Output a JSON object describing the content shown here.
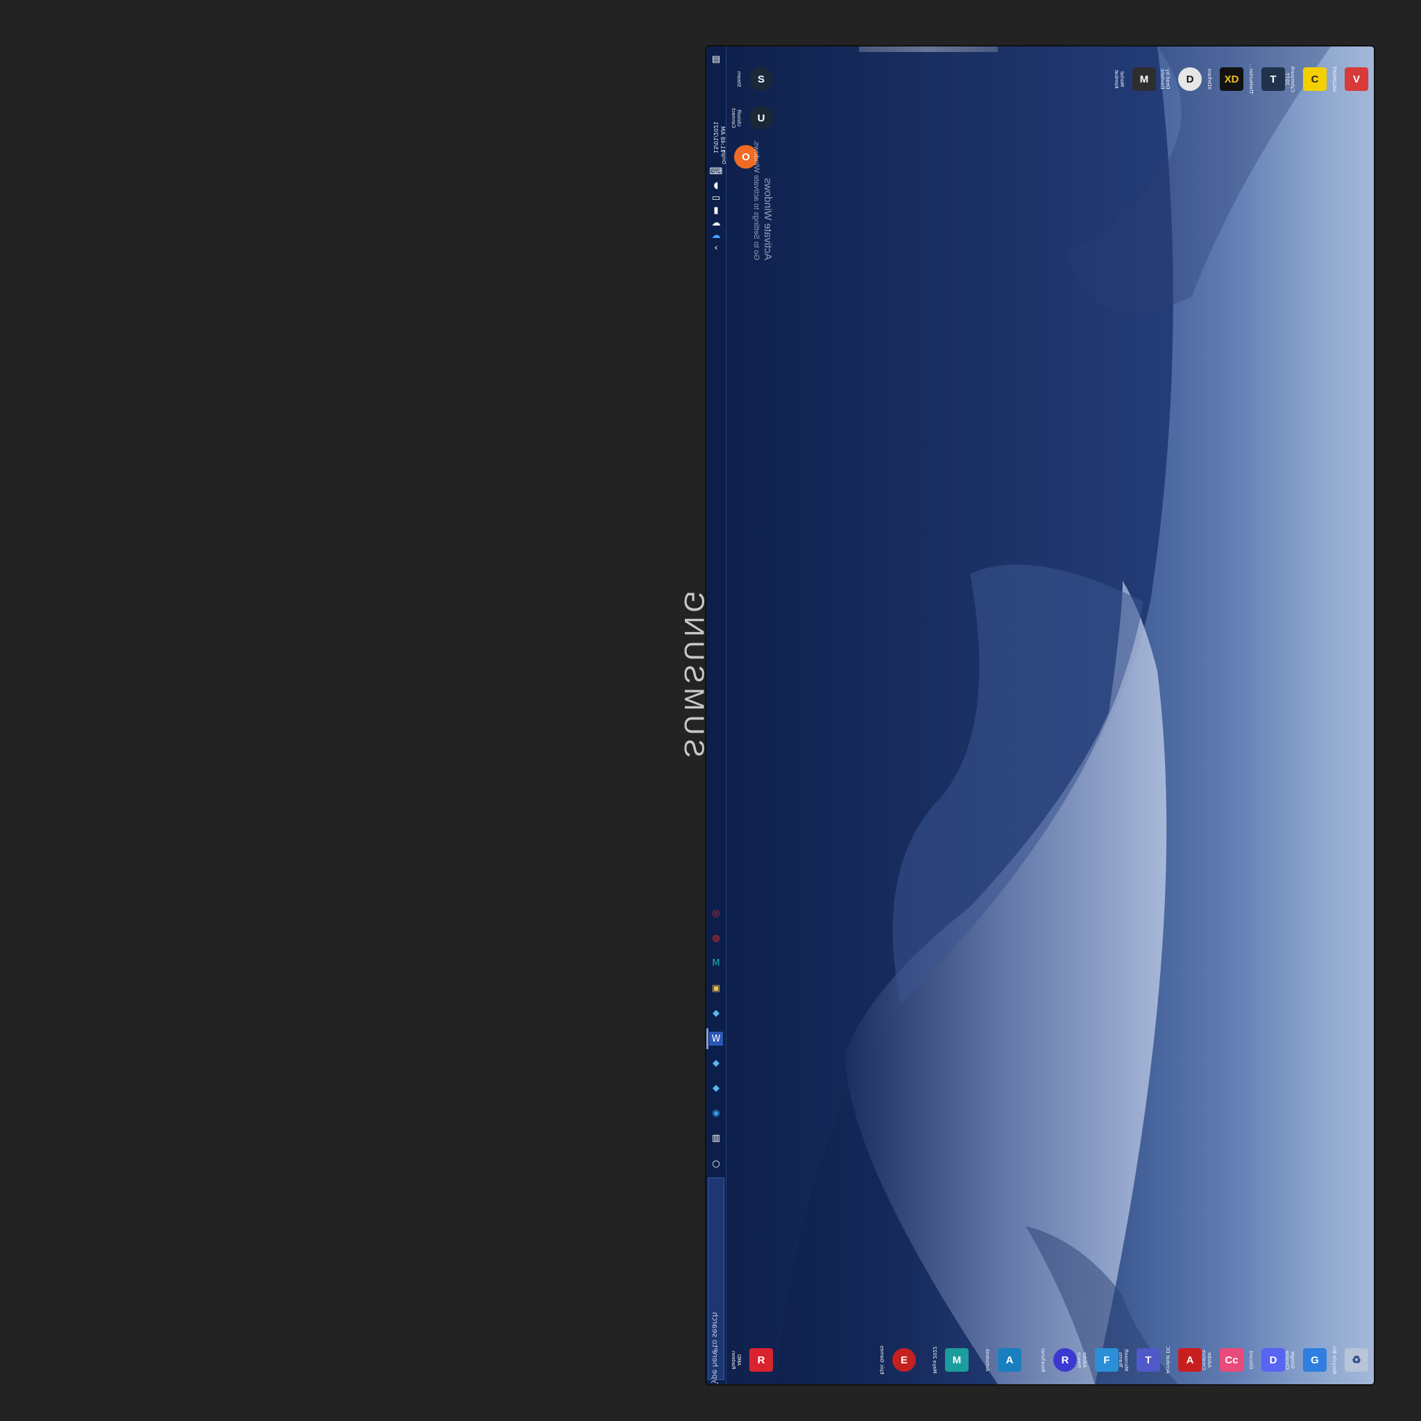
{
  "monitor_brand": "SUMSUNG",
  "taskbar": {
    "search_placeholder": "Type here to search",
    "clock_time": "11:48 AM",
    "clock_date": "15/01/2021",
    "tray_icons": [
      "chevron-up-icon",
      "onedrive-icon",
      "onedrive-icon",
      "network-icon",
      "battery-icon",
      "volume-icon",
      "language-icon",
      "notification-icon"
    ],
    "pinned": [
      "task-view-icon",
      "cortana-icon",
      "edge-icon",
      "edge-icon",
      "photoshop-icon",
      "word-icon",
      "edge-icon",
      "file-explorer-icon",
      "maya-icon",
      "ea-icon",
      "red-app-icon"
    ]
  },
  "desktop_top_icons": [
    {
      "label": "VALORANT",
      "color": "#d83a3a",
      "glyph": "V"
    },
    {
      "label": "Cyberpunk 2077",
      "color": "#f4d000",
      "glyph": "C"
    },
    {
      "label": "TheHunter...",
      "color": "#20324c",
      "glyph": "T"
    },
    {
      "label": "XDefiant",
      "color": "#121212",
      "glyph": "XD"
    },
    {
      "label": "Dead by Daylight",
      "color": "#e6e6e6",
      "glyph": "D"
    },
    {
      "label": "Mortal Kombat",
      "color": "#2e2e2e",
      "glyph": "M"
    }
  ],
  "desktop_bottom_icons": [
    {
      "label": "Recycle Bin",
      "color": "#b8c4d8",
      "glyph": "♻"
    },
    {
      "label": "Google Chrome",
      "color": "#2f7ee0",
      "glyph": "G"
    },
    {
      "label": "Discord",
      "color": "#5865f2",
      "glyph": "D"
    },
    {
      "label": "Adobe Creative",
      "color": "#e94b7a",
      "glyph": "Cc"
    },
    {
      "label": "Acrobat DC",
      "color": "#c81e1e",
      "glyph": "A"
    },
    {
      "label": "Microsoft Teams",
      "color": "#5059c9",
      "glyph": "T"
    },
    {
      "label": "Adobe Fresco",
      "color": "#2a8fd8",
      "glyph": "F"
    },
    {
      "label": "RivaTuner",
      "color": "#3a3ad0",
      "glyph": "R"
    },
    {
      "label": "Autodesk",
      "color": "#1a7fbf",
      "glyph": "A"
    },
    {
      "label": "Maya 2022",
      "color": "#1b9d9d",
      "glyph": "M"
    },
    {
      "label": "Epic Games",
      "color": "#c42020",
      "glyph": "E"
    }
  ],
  "desktop_left_icons": [
    {
      "label": "Steam",
      "color": "#1b2838",
      "glyph": "S"
    },
    {
      "label": "Ubisoft Connect",
      "color": "#1b2838",
      "glyph": "U"
    },
    {
      "label": "Origin",
      "color": "#f06b24",
      "glyph": "O"
    },
    {
      "label": "AMD Radeon Software",
      "color": "#d9232f",
      "glyph": "R"
    }
  ],
  "activation": {
    "title": "Activate Windows",
    "subtitle": "Go to Settings to activate Windows."
  },
  "colors": {
    "taskbar": "#0b1f4a",
    "wallpaper_dark": "#0c1c44",
    "wallpaper_light": "#a4b8d8"
  }
}
